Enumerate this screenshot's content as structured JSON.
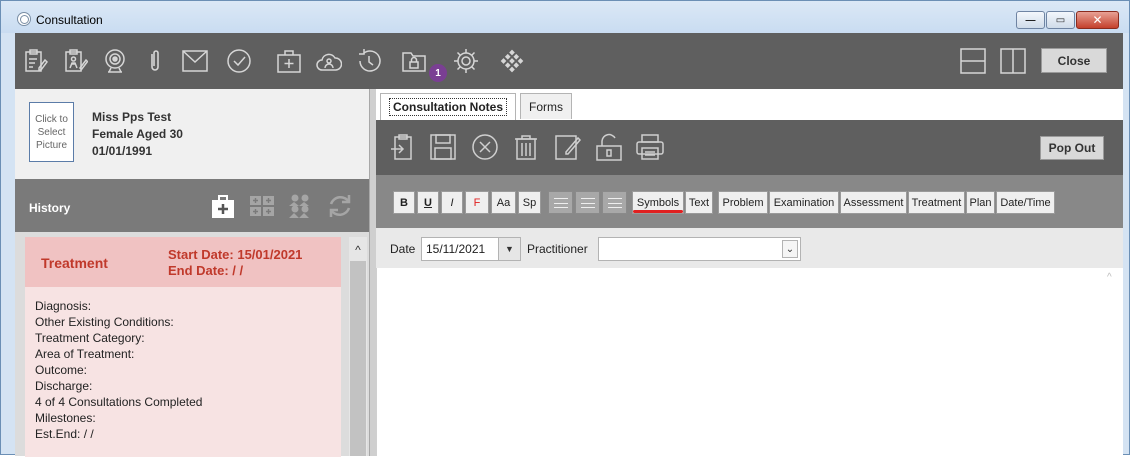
{
  "window": {
    "title": "Consultation",
    "app_icon": "app-logo-icon",
    "controls": {
      "minimize": "—",
      "maximize": "▭",
      "close": "✕"
    }
  },
  "main_toolbar": {
    "icons": [
      "clipboard-edit-icon",
      "clipboard-person-icon",
      "webcam-icon",
      "paperclip-icon",
      "envelope-icon",
      "checkmark-circle-icon",
      "medical-kit-icon",
      "cloud-people-icon",
      "history-clock-icon",
      "folder-lock-icon",
      "gear-icon",
      "grid-diamond-icon",
      "layout-horizontal-icon",
      "layout-vertical-icon"
    ],
    "folder_badge": "1",
    "close_label": "Close"
  },
  "patient": {
    "picture_prompt": "Click to Select Picture",
    "name": "Miss Pps Test",
    "gender_age": "Female Aged 30",
    "dob": "01/01/1991"
  },
  "history": {
    "label": "History",
    "icons": [
      "add-medical-icon",
      "medical-grid-icon",
      "people-group-icon",
      "refresh-icon"
    ],
    "card": {
      "title": "Treatment",
      "start_date": "Start Date: 15/01/2021",
      "end_date": "End Date: / /",
      "lines": [
        "Diagnosis:",
        "Other Existing Conditions:",
        "Treatment Category:",
        "Area of Treatment:",
        "Outcome:",
        "Discharge:",
        "4 of 4 Consultations Completed",
        "Milestones:",
        "Est.End: / /"
      ]
    },
    "scroll_up": "^"
  },
  "tabs": [
    {
      "label": "Consultation Notes",
      "active": true
    },
    {
      "label": "Forms",
      "active": false
    }
  ],
  "notes_toolbar": {
    "icons": [
      "import-icon",
      "save-icon",
      "cancel-circle-icon",
      "trash-icon",
      "edit-note-icon",
      "unlock-icon",
      "printer-icon"
    ],
    "popout_label": "Pop Out"
  },
  "format_bar": {
    "buttons": [
      "B",
      "U",
      "I",
      "F",
      "Aa",
      "Sp"
    ],
    "align": [
      "align-left-icon",
      "align-center-icon",
      "align-right-icon"
    ],
    "inserts": [
      "Symbols",
      "Text",
      "Problem",
      "Examination",
      "Assessment",
      "Treatment",
      "Plan",
      "Date/Time"
    ],
    "accent_color": "#e02020"
  },
  "date_bar": {
    "date_label": "Date",
    "date_value": "15/11/2021",
    "practitioner_label": "Practitioner",
    "practitioner_value": ""
  }
}
